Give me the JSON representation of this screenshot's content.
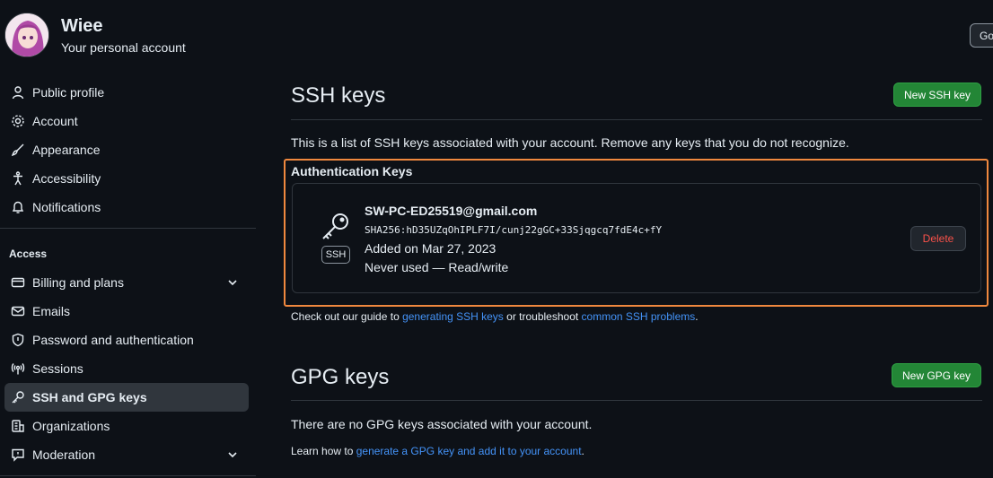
{
  "account": {
    "name": "Wiee",
    "subtitle": "Your personal account",
    "go_button": "Go"
  },
  "sidebar": {
    "items": [
      {
        "label": "Public profile",
        "icon": "person-icon"
      },
      {
        "label": "Account",
        "icon": "gear-icon"
      },
      {
        "label": "Appearance",
        "icon": "paintbrush-icon"
      },
      {
        "label": "Accessibility",
        "icon": "accessibility-icon"
      },
      {
        "label": "Notifications",
        "icon": "bell-icon"
      }
    ],
    "access_heading": "Access",
    "access_items": [
      {
        "label": "Billing and plans",
        "icon": "credit-card-icon",
        "expandable": true
      },
      {
        "label": "Emails",
        "icon": "mail-icon"
      },
      {
        "label": "Password and authentication",
        "icon": "shield-icon"
      },
      {
        "label": "Sessions",
        "icon": "broadcast-icon"
      },
      {
        "label": "SSH and GPG keys",
        "icon": "key-icon",
        "active": true
      },
      {
        "label": "Organizations",
        "icon": "organization-icon"
      },
      {
        "label": "Moderation",
        "icon": "report-icon",
        "expandable": true
      }
    ]
  },
  "ssh": {
    "title": "SSH keys",
    "new_button": "New SSH key",
    "description": "This is a list of SSH keys associated with your account. Remove any keys that you do not recognize.",
    "auth_heading": "Authentication Keys",
    "key": {
      "title": "SW-PC-ED25519@gmail.com",
      "fingerprint": "SHA256:hD35UZqOhIPLF7I/cunj22gGC+33Sjqgcq7fdE4c+fY",
      "added": "Added on Mar 27, 2023",
      "usage": "Never used — Read/write",
      "badge": "SSH",
      "delete_label": "Delete"
    },
    "guide": {
      "prefix": "Check out our guide to ",
      "link1": "generating SSH keys",
      "middle": " or troubleshoot ",
      "link2": "common SSH problems",
      "suffix": "."
    }
  },
  "gpg": {
    "title": "GPG keys",
    "new_button": "New GPG key",
    "empty": "There are no GPG keys associated with your account.",
    "learn_prefix": "Learn how to ",
    "learn_link": "generate a GPG key and add it to your account",
    "learn_suffix": "."
  },
  "colors": {
    "background": "#0d1117",
    "accent_green": "#238636",
    "link": "#4493f8",
    "danger": "#f85149",
    "highlight": "#f0883e"
  }
}
